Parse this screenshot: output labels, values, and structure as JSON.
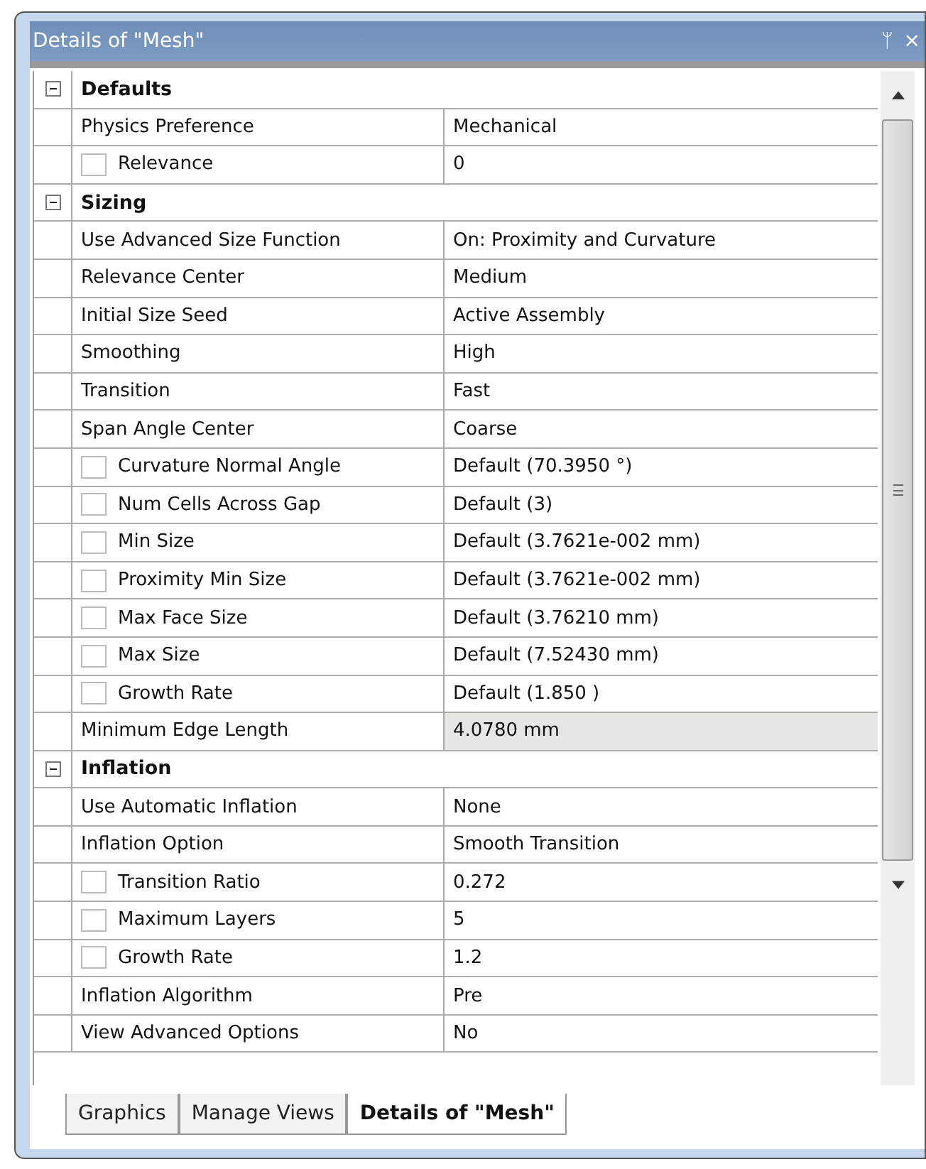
{
  "window": {
    "title": "Details of \"Mesh\"",
    "pin": "ᛘ",
    "close": "×"
  },
  "groups": [
    {
      "title": "Defaults",
      "expanded": true,
      "rows": [
        {
          "label": "Physics Preference",
          "value": "Mechanical",
          "kind": "plain"
        },
        {
          "label": "Relevance",
          "value": "0",
          "kind": "checkbox",
          "checked": false
        }
      ]
    },
    {
      "title": "Sizing",
      "expanded": true,
      "rows": [
        {
          "label": "Use Advanced Size Function",
          "value": "On: Proximity and Curvature",
          "kind": "plain"
        },
        {
          "label": "Relevance Center",
          "value": "Medium",
          "kind": "plain"
        },
        {
          "label": "Initial Size Seed",
          "value": "Active Assembly",
          "kind": "plain"
        },
        {
          "label": "Smoothing",
          "value": "High",
          "kind": "plain"
        },
        {
          "label": "Transition",
          "value": "Fast",
          "kind": "plain"
        },
        {
          "label": "Span Angle Center",
          "value": "Coarse",
          "kind": "plain"
        },
        {
          "label": "Curvature Normal Angle",
          "value": "Default (70.3950 °)",
          "kind": "checkbox",
          "checked": false
        },
        {
          "label": "Num Cells Across Gap",
          "value": "Default (3)",
          "kind": "checkbox",
          "checked": false
        },
        {
          "label": "Min Size",
          "value": "Default (3.7621e-002 mm)",
          "kind": "checkbox",
          "checked": false
        },
        {
          "label": "Proximity Min Size",
          "value": "Default (3.7621e-002 mm)",
          "kind": "checkbox",
          "checked": false
        },
        {
          "label": "Max Face Size",
          "value": "Default (3.76210 mm)",
          "kind": "checkbox",
          "checked": false
        },
        {
          "label": "Max Size",
          "value": "Default (7.52430 mm)",
          "kind": "checkbox",
          "checked": false
        },
        {
          "label": "Growth Rate",
          "value": "Default (1.850 )",
          "kind": "checkbox",
          "checked": false
        },
        {
          "label": "Minimum Edge Length",
          "value": "4.0780 mm",
          "kind": "readonly"
        }
      ]
    },
    {
      "title": "Inflation",
      "expanded": true,
      "rows": [
        {
          "label": "Use Automatic Inflation",
          "value": "None",
          "kind": "plain"
        },
        {
          "label": "Inflation Option",
          "value": "Smooth Transition",
          "kind": "plain"
        },
        {
          "label": "Transition Ratio",
          "value": "0.272",
          "kind": "checkbox",
          "checked": false
        },
        {
          "label": "Maximum Layers",
          "value": "5",
          "kind": "checkbox",
          "checked": false
        },
        {
          "label": "Growth Rate",
          "value": "1.2",
          "kind": "checkbox",
          "checked": false
        },
        {
          "label": "Inflation Algorithm",
          "value": "Pre",
          "kind": "plain"
        },
        {
          "label": "View Advanced Options",
          "value": "No",
          "kind": "plain"
        }
      ]
    }
  ],
  "tabs": [
    {
      "label": "Graphics",
      "selected": false
    },
    {
      "label": "Manage Views",
      "selected": false
    },
    {
      "label": "Details of \"Mesh\"",
      "selected": true
    }
  ]
}
